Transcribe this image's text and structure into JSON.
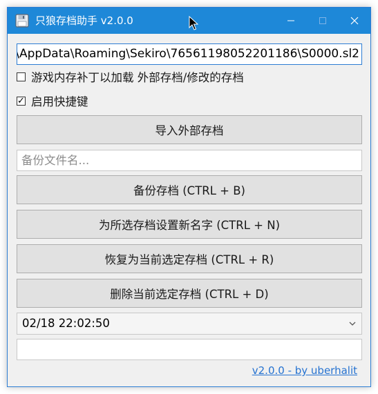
{
  "window": {
    "title": "只狼存档助手 v2.0.0",
    "controls": {
      "minimize": "minimize-icon",
      "maximize": "maximize-icon",
      "close": "close-icon"
    }
  },
  "save_path": {
    "value": "\\AppData\\Roaming\\Sekiro\\76561198052201186\\S0000.sl2"
  },
  "options": {
    "patch_label": "游戏内存补丁以加载 外部存档/修改的存档",
    "patch_checked": false,
    "hotkeys_label": "启用快捷键",
    "hotkeys_checked": true
  },
  "buttons": {
    "import": "导入外部存档",
    "backup": "备份存档 (CTRL + B)",
    "rename": "为所选存档设置新名字 (CTRL + N)",
    "restore": "恢复为当前选定存档 (CTRL + R)",
    "delete": "删除当前选定存档 (CTRL + D)"
  },
  "backup_name": {
    "placeholder": "备份文件名...",
    "value": ""
  },
  "save_select": {
    "selected": "02/18 22:02:50"
  },
  "footer": {
    "version_link": "v2.0.0 - by uberhalit"
  },
  "colors": {
    "titlebar": "#1e88d8",
    "link": "#2673d1",
    "focus_border": "#2b7cd3"
  }
}
